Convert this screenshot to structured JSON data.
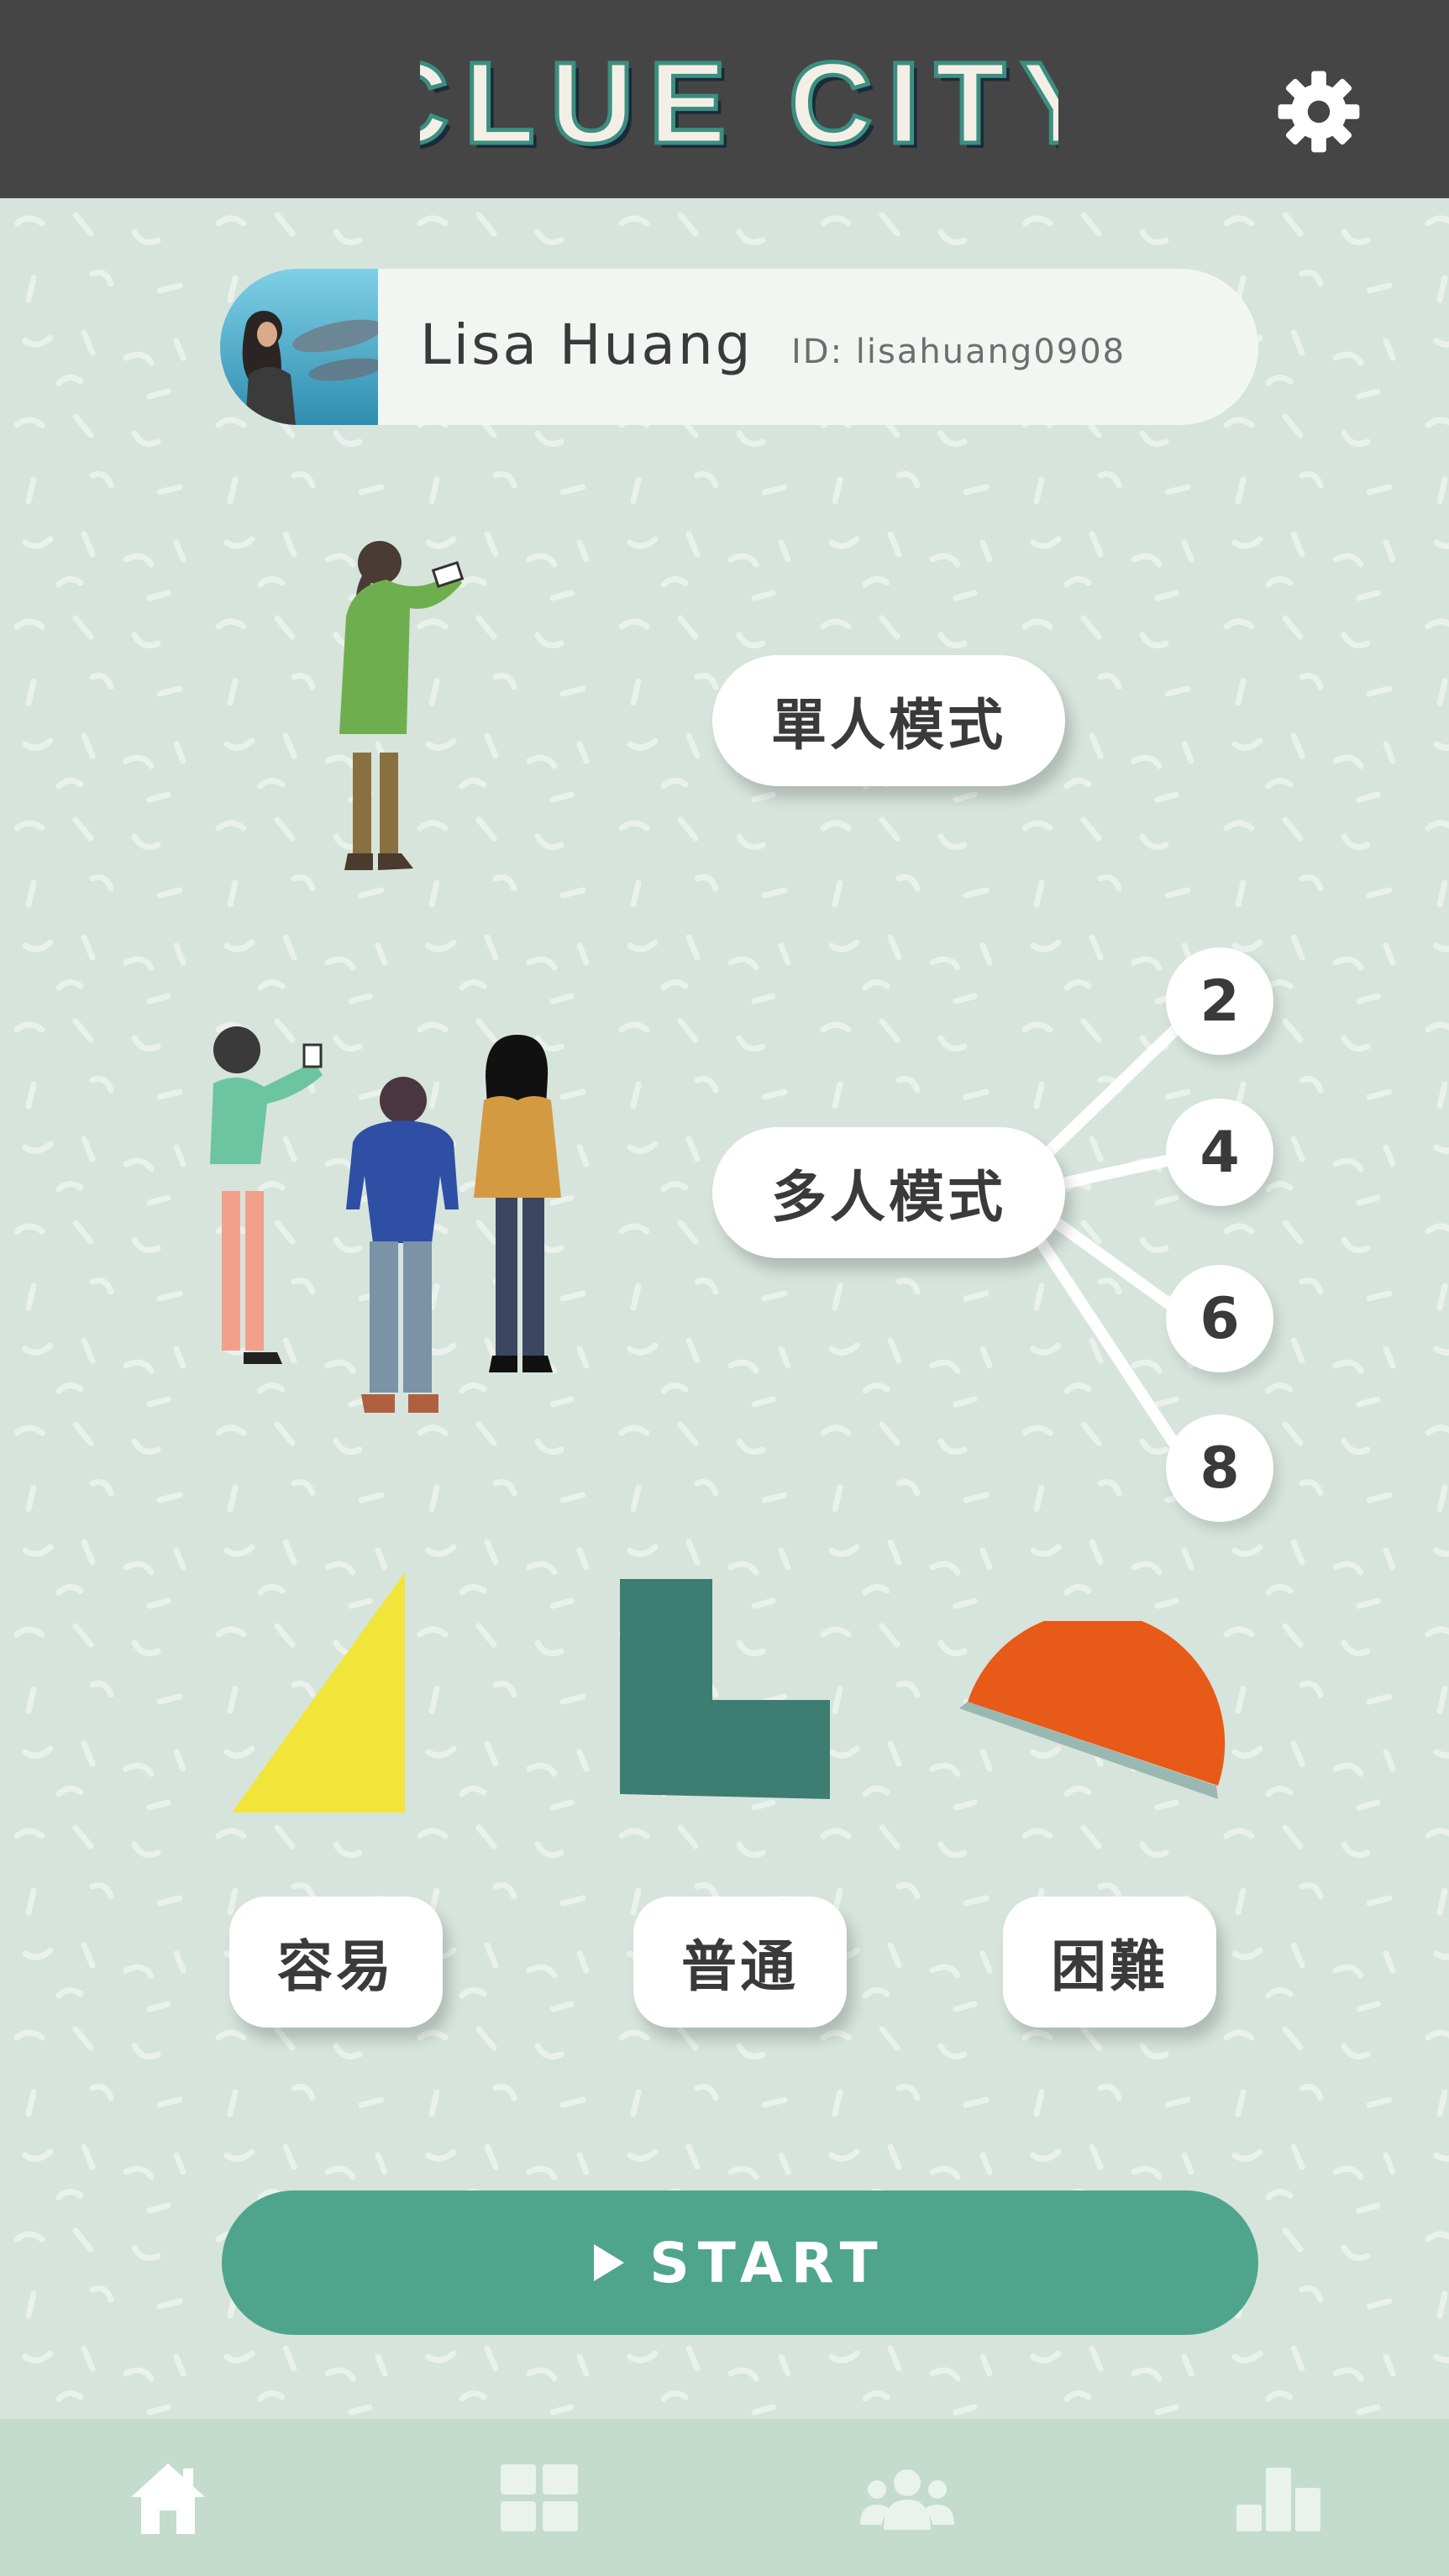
{
  "header": {
    "logo_text": "CLUE CITY",
    "settings_icon": "gear-icon"
  },
  "profile": {
    "name": "Lisa Huang",
    "id_text": "ID: lisahuang0908"
  },
  "modes": {
    "single_label": "單人模式",
    "multi_label": "多人模式",
    "player_counts": [
      "2",
      "4",
      "6",
      "8"
    ]
  },
  "difficulty": {
    "easy": "容易",
    "normal": "普通",
    "hard": "困難"
  },
  "start": {
    "label": "START",
    "icon": "play-icon"
  },
  "bottom_nav": {
    "items": [
      "home-icon",
      "grid-icon",
      "friends-icon",
      "stats-icon"
    ],
    "active": "home-icon"
  },
  "colors": {
    "header_bg": "#454545",
    "page_bg": "#d6e4dc",
    "accent_green": "#4fa58b",
    "nav_bg": "#c3dccd",
    "triangle_yellow": "#f2e53a",
    "l_shape_teal": "#3d7d72",
    "semicircle_orange": "#e85a17"
  }
}
